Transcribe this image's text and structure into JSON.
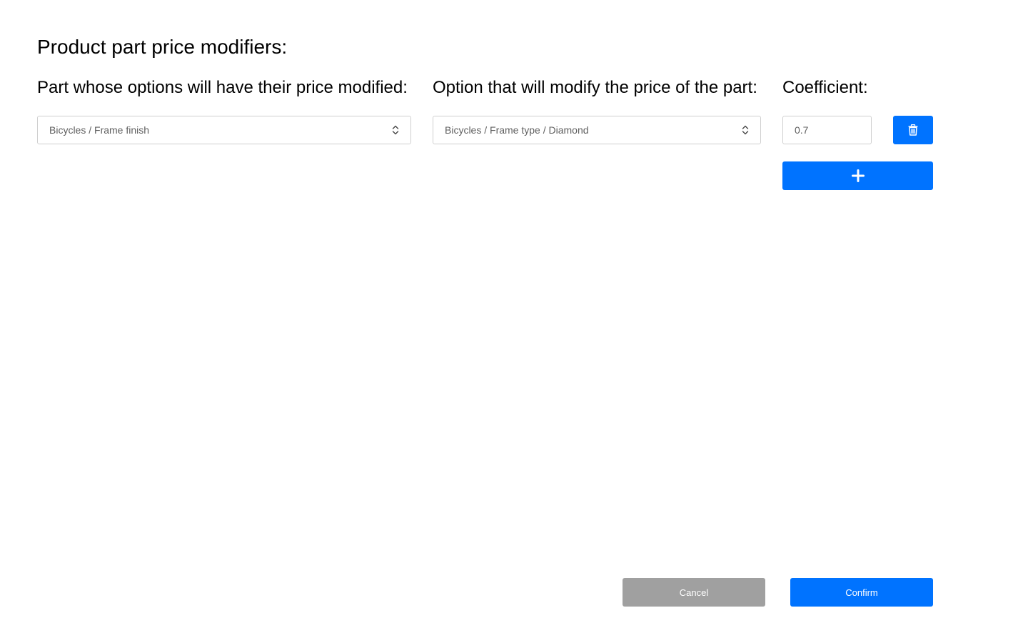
{
  "page": {
    "title": "Product part price modifiers:"
  },
  "columns": {
    "part_heading": "Part whose options will have their price modified:",
    "option_heading": "Option that will modify the price of the part:",
    "coefficient_heading": "Coefficient:"
  },
  "modifier_rows": [
    {
      "part": "Bicycles / Frame finish",
      "option": "Bicycles / Frame type / Diamond",
      "coefficient": "0.7"
    }
  ],
  "icons": {
    "delete": "trash-icon",
    "add": "plus-icon",
    "select_indicator": "chevron-up-down-icon"
  },
  "footer": {
    "cancel_label": "Cancel",
    "confirm_label": "Confirm"
  },
  "colors": {
    "primary": "#0073ff",
    "cancel": "#a0a0a0",
    "border": "#cfcfcf",
    "field_text": "#5f5f5f"
  }
}
